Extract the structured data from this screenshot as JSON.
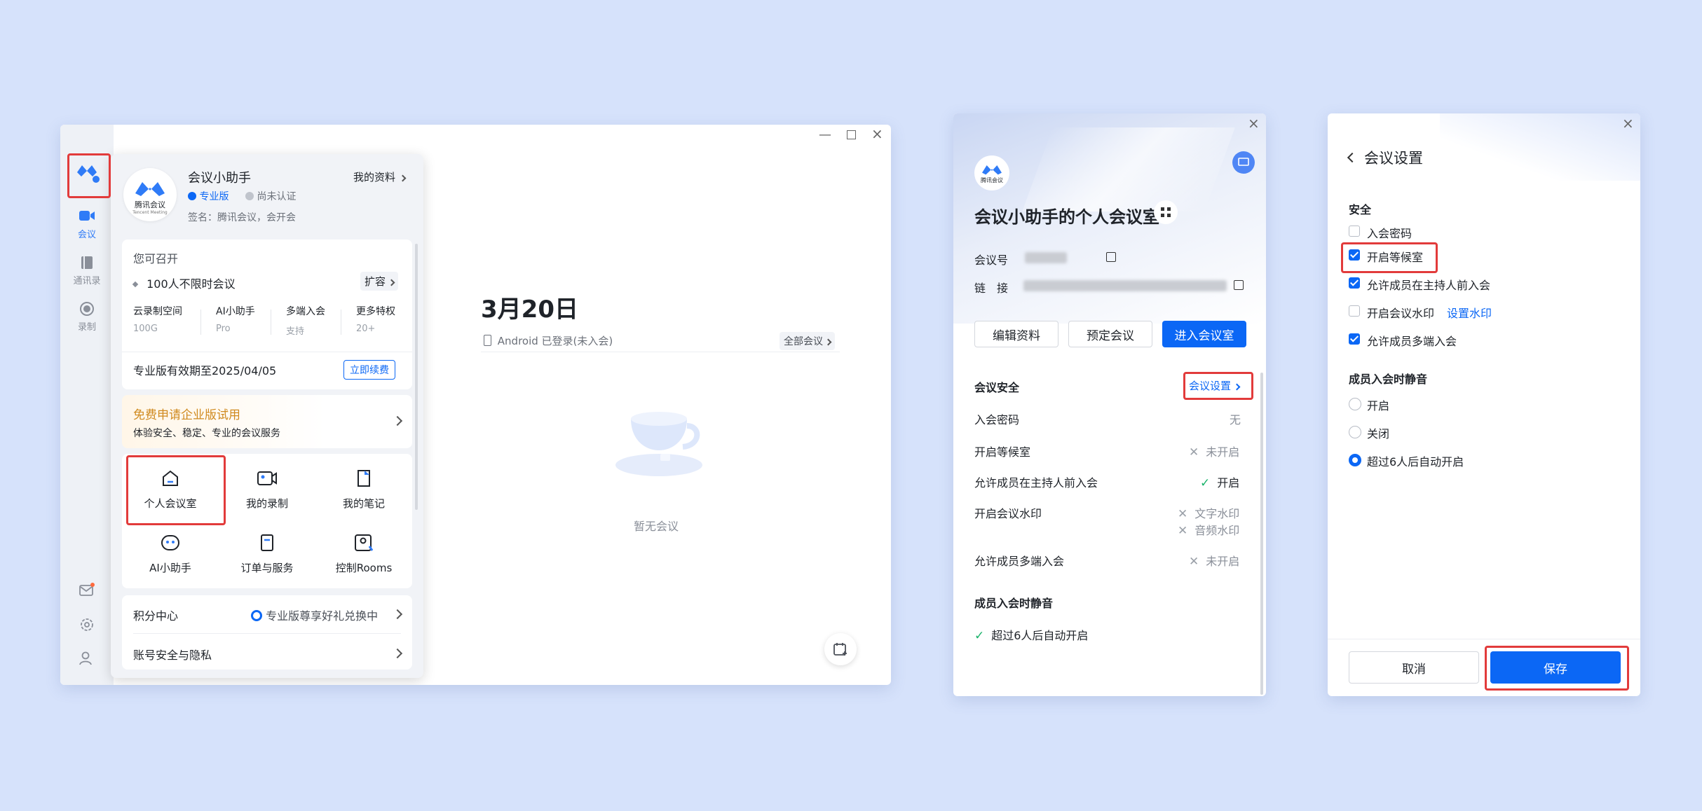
{
  "main_window": {
    "nav": {
      "meeting": "会议",
      "contacts": "通讯录",
      "record": "录制"
    },
    "profile": {
      "logo_text": "腾讯会议",
      "logo_sub": "Tencent Meeting",
      "name": "会议小助手",
      "my_profile": "我的资料",
      "edition": "专业版",
      "verify": "尚未认证",
      "signature": "签名：腾讯会议，会开会"
    },
    "quota": {
      "title": "您可召开",
      "capacity": "100人不限时会议",
      "expand": "扩容",
      "items": [
        {
          "label": "云录制空间",
          "value": "100G"
        },
        {
          "label": "AI小助手",
          "value": "Pro"
        },
        {
          "label": "多端入会",
          "value": "支持"
        },
        {
          "label": "更多特权",
          "value": "20+"
        }
      ],
      "expiry": "专业版有效期至2025/04/05",
      "renew": "立即续费"
    },
    "trial": {
      "title": "免费申请企业版试用",
      "desc": "体验安全、稳定、专业的会议服务"
    },
    "grid": [
      "个人会议室",
      "我的录制",
      "我的笔记",
      "AI小助手",
      "订单与服务",
      "控制Rooms"
    ],
    "points": {
      "label": "积分中心",
      "promo": "专业版尊享好礼兑换中"
    },
    "account": "账号安全与隐私",
    "date": "3月20日",
    "device_status": "Android 已登录(未入会)",
    "all_meetings": "全部会议",
    "empty": "暂无会议"
  },
  "room_panel": {
    "logo_text": "腾讯会议",
    "title": "会议小助手的个人会议室",
    "meeting_id_label": "会议号",
    "link_label": "链　接",
    "buttons": {
      "edit": "编辑资料",
      "schedule": "预定会议",
      "enter": "进入会议室"
    },
    "security_title": "会议安全",
    "settings_link": "会议设置",
    "rows": [
      {
        "label": "入会密码",
        "value": "无"
      },
      {
        "label": "开启等候室",
        "value": "未开启"
      },
      {
        "label": "允许成员在主持人前入会",
        "value": "开启"
      },
      {
        "label": "开启会议水印",
        "value": "文字水印",
        "value2": "音频水印"
      },
      {
        "label": "允许成员多端入会",
        "value": "未开启"
      }
    ],
    "mute_title": "成员入会时静音",
    "mute_value": "超过6人后自动开启"
  },
  "settings_panel": {
    "title": "会议设置",
    "security": "安全",
    "options": [
      {
        "label": "入会密码",
        "checked": false
      },
      {
        "label": "开启等候室",
        "checked": true
      },
      {
        "label": "允许成员在主持人前入会",
        "checked": true
      },
      {
        "label": "开启会议水印",
        "checked": false,
        "link": "设置水印"
      },
      {
        "label": "允许成员多端入会",
        "checked": true
      }
    ],
    "mute_title": "成员入会时静音",
    "mute_options": [
      {
        "label": "开启",
        "selected": false
      },
      {
        "label": "关闭",
        "selected": false
      },
      {
        "label": "超过6人后自动开启",
        "selected": true
      }
    ],
    "cancel": "取消",
    "save": "保存"
  },
  "colors": {
    "accent": "#0b67f5",
    "highlight": "#e23b3b",
    "background": "#d6e2fb"
  }
}
